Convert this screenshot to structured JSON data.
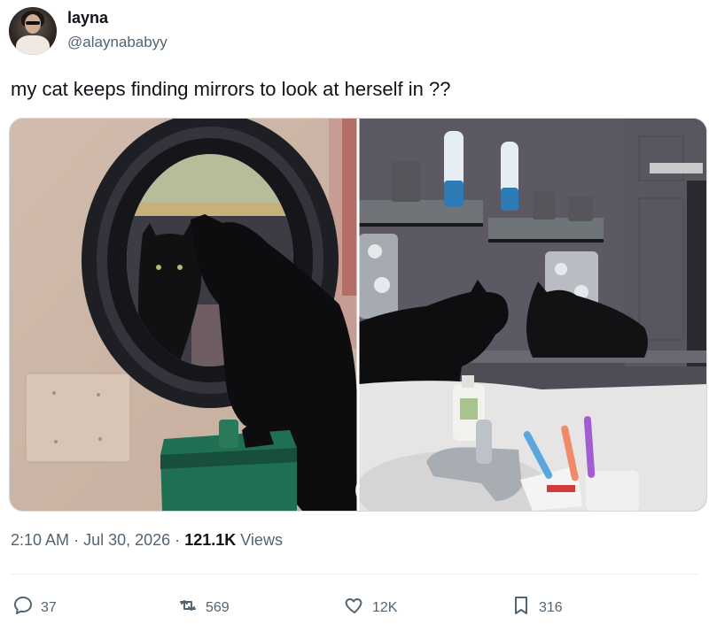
{
  "author": {
    "display_name": "layna",
    "handle": "@alaynababyy"
  },
  "tweet": {
    "text": "my cat keeps finding mirrors to look at herself in ??"
  },
  "meta": {
    "time": "2:10 AM",
    "separator": "·",
    "date": "Jul 30, 2026",
    "views_count": "121.1K",
    "views_label": "Views"
  },
  "actions": {
    "replies": "37",
    "reposts": "569",
    "likes": "12K",
    "bookmarks": "316"
  },
  "icons": {
    "reply": "speech-bubble",
    "repost": "retweet-arrows",
    "like": "heart",
    "bookmark": "bookmark"
  }
}
